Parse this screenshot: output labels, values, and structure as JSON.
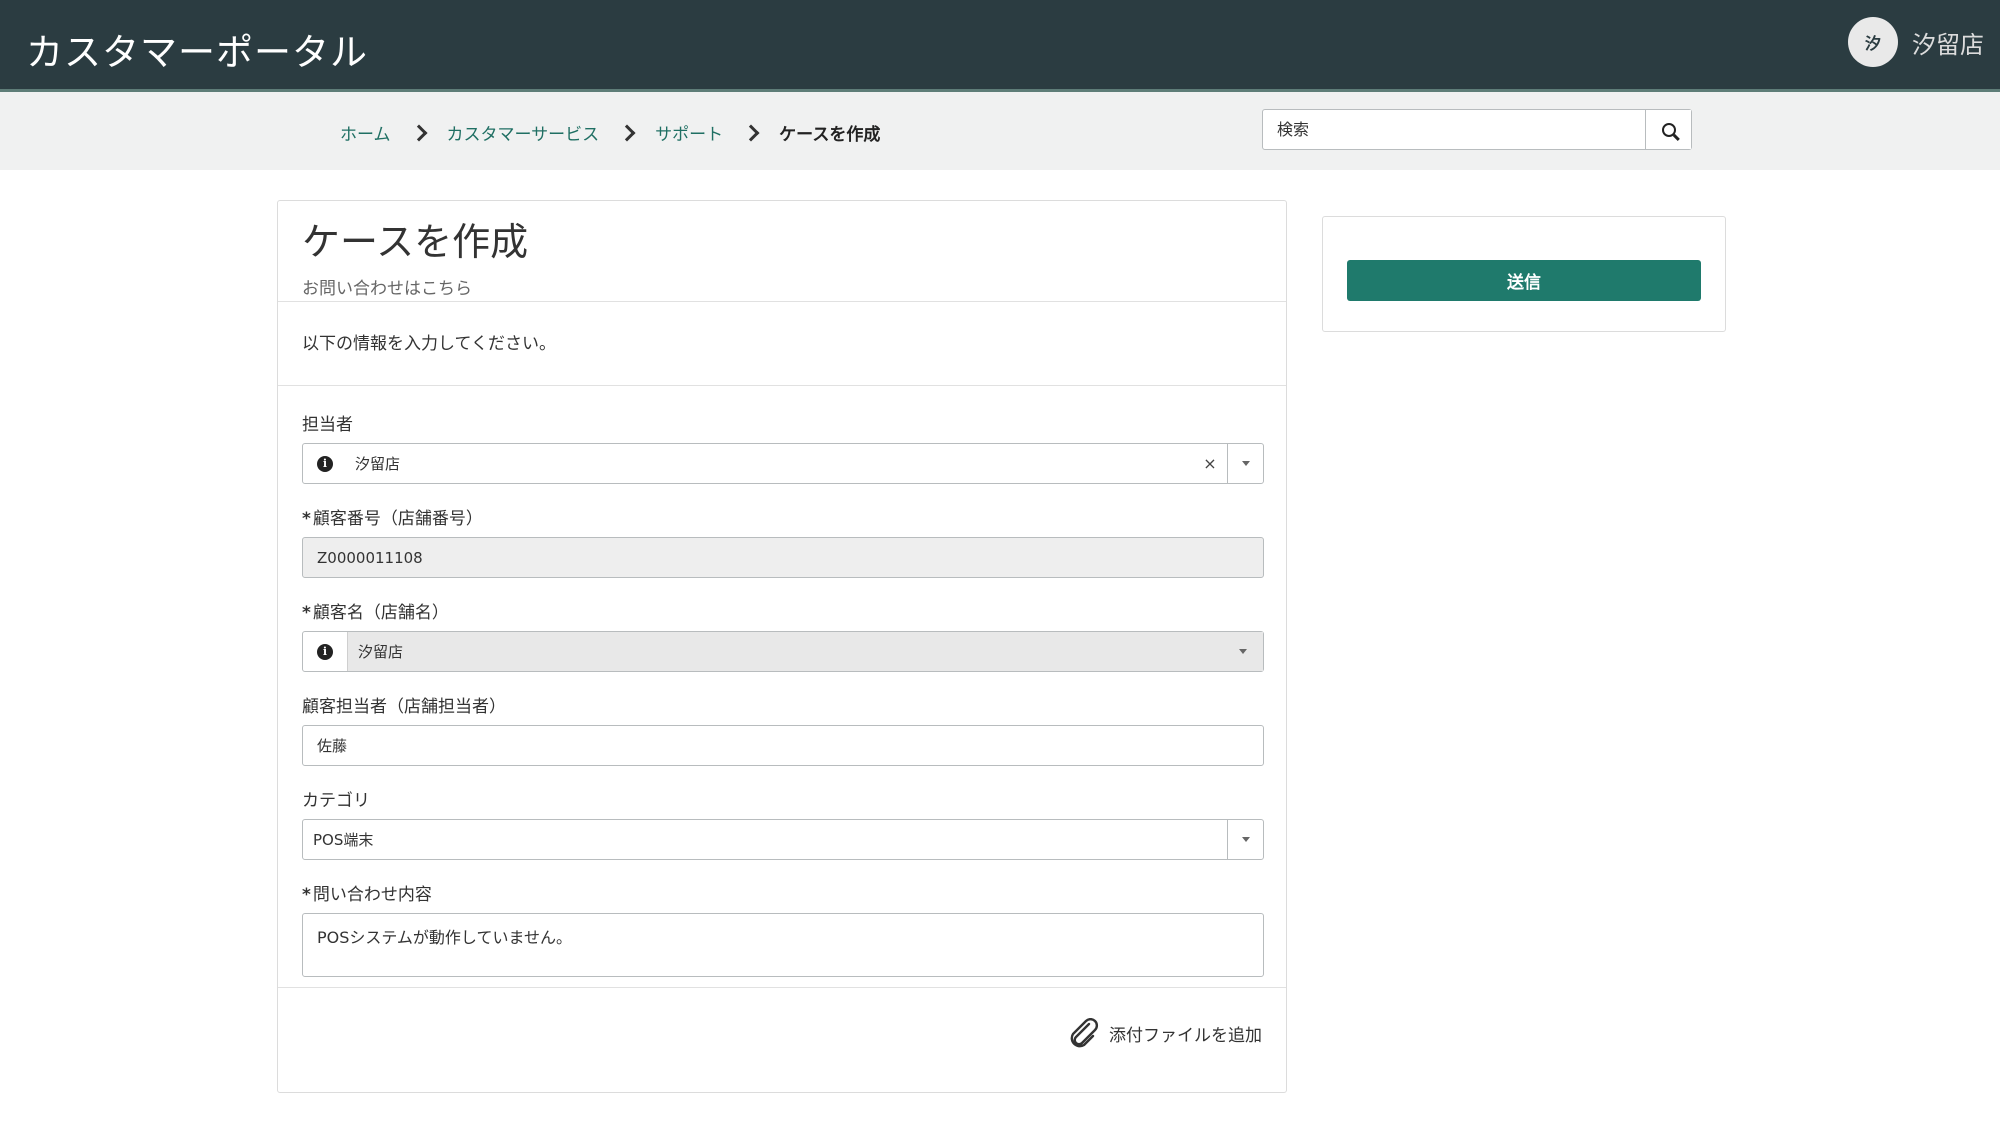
{
  "header": {
    "app_title": "カスタマーポータル",
    "avatar_initial": "汐",
    "user_name": "汐留店"
  },
  "breadcrumb": {
    "items": [
      {
        "label": "ホーム"
      },
      {
        "label": "カスタマーサービス"
      },
      {
        "label": "サポート"
      },
      {
        "label": "ケースを作成"
      }
    ]
  },
  "search": {
    "placeholder": "検索"
  },
  "page": {
    "title": "ケースを作成",
    "subtitle": "お問い合わせはこちら",
    "instruction": "以下の情報を入力してください。"
  },
  "form": {
    "assignee": {
      "label": "担当者",
      "value": "汐留店"
    },
    "customer_number": {
      "required_mark": "*",
      "label": "顧客番号（店舗番号）",
      "value": "Z0000011108"
    },
    "customer_name": {
      "required_mark": "*",
      "label": "顧客名（店舗名）",
      "value": "汐留店"
    },
    "customer_contact": {
      "label": "顧客担当者（店舗担当者）",
      "value": "佐藤"
    },
    "category": {
      "label": "カテゴリ",
      "value": "POS端末"
    },
    "inquiry": {
      "required_mark": "*",
      "label": "問い合わせ内容",
      "value": "POSシステムが動作していません。"
    }
  },
  "attach": {
    "label": "添付ファイルを追加",
    "icon": "paperclip-icon"
  },
  "actions": {
    "submit_label": "送信"
  },
  "colors": {
    "header_bg": "#2b3c41",
    "accent": "#1f7a6c",
    "link": "#1f6f63"
  }
}
